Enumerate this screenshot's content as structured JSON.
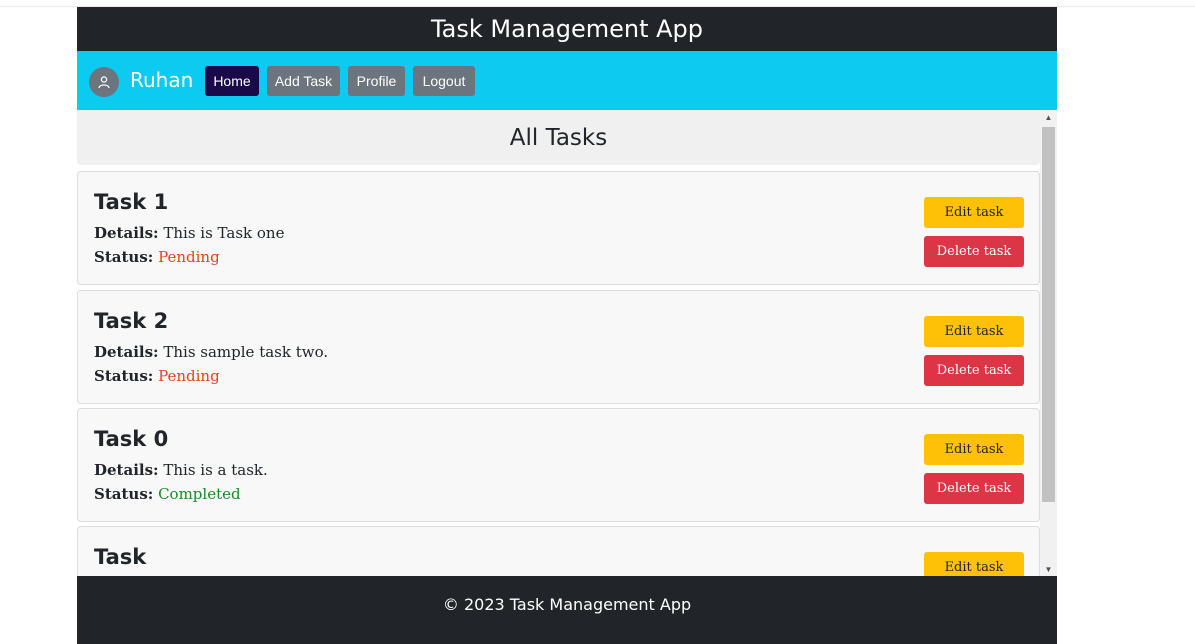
{
  "app": {
    "title": "Task Management App"
  },
  "user": {
    "name": "Ruhan"
  },
  "nav": [
    {
      "label": "Home",
      "active": true
    },
    {
      "label": "Add Task",
      "active": false
    },
    {
      "label": "Profile",
      "active": false
    },
    {
      "label": "Logout",
      "active": false
    }
  ],
  "page": {
    "heading": "All Tasks"
  },
  "labels": {
    "details": "Details:",
    "status": "Status:",
    "edit": "Edit task",
    "delete": "Delete task"
  },
  "tasks": [
    {
      "title": "Task 1",
      "details": "This is Task one",
      "status": "Pending"
    },
    {
      "title": "Task 2",
      "details": "This sample task two.",
      "status": "Pending"
    },
    {
      "title": "Task 0",
      "details": "This is a task.",
      "status": "Completed"
    },
    {
      "title": "Task",
      "details": "",
      "status": ""
    }
  ],
  "footer": {
    "text": "© 2023 Task Management App"
  },
  "colors": {
    "navbar": "#0dcaf0",
    "title_bar": "#212529",
    "active_nav": "#1a0a4a",
    "secondary": "#6c757d",
    "edit": "#ffc107",
    "delete": "#dc3545",
    "pending": "#e8411a",
    "completed": "#198a2a"
  }
}
